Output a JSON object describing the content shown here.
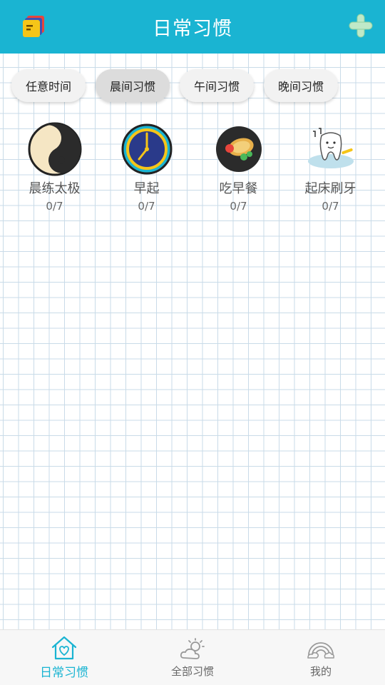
{
  "header": {
    "title": "日常习惯",
    "left_icon": "notes-icon",
    "right_icon": "add-icon",
    "background": "#1ab4d2"
  },
  "tabs": [
    {
      "label": "任意时间",
      "active": false
    },
    {
      "label": "晨间习惯",
      "active": true
    },
    {
      "label": "午间习惯",
      "active": false
    },
    {
      "label": "晚间习惯",
      "active": false
    }
  ],
  "habits": [
    {
      "name": "晨练太极",
      "count": "0/7",
      "icon": "yin-yang-icon"
    },
    {
      "name": "早起",
      "count": "0/7",
      "icon": "clock-icon"
    },
    {
      "name": "吃早餐",
      "count": "0/7",
      "icon": "breakfast-icon"
    },
    {
      "name": "起床刷牙",
      "count": "0/7",
      "icon": "tooth-icon"
    }
  ],
  "bottom_nav": [
    {
      "label": "日常习惯",
      "icon": "home-heart-icon",
      "active": true
    },
    {
      "label": "全部习惯",
      "icon": "sun-cloud-icon",
      "active": false
    },
    {
      "label": "我的",
      "icon": "rainbow-icon",
      "active": false
    }
  ],
  "colors": {
    "accent": "#1ab4d2",
    "grid": "#c9dbe8"
  }
}
